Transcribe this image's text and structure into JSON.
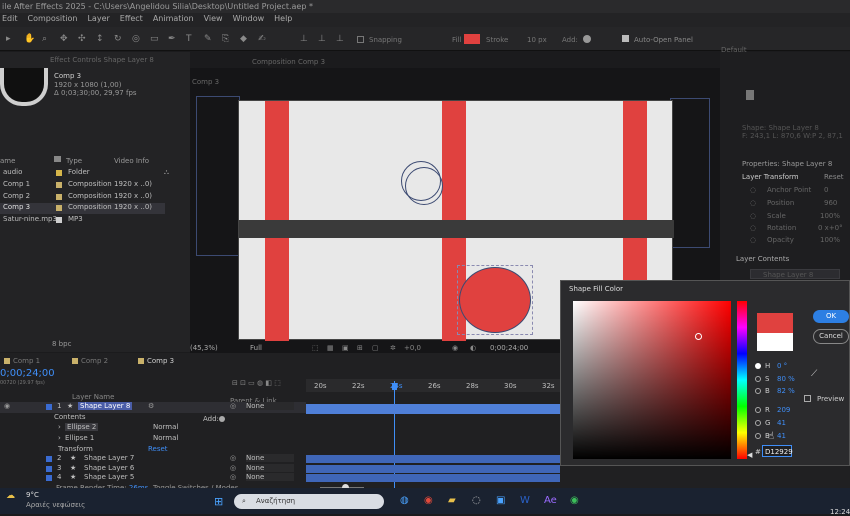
{
  "window": {
    "title": "ile After Effects 2025 - C:\\Users\\Angelidou Silia\\Desktop\\Untitled Project.aep *"
  },
  "menu": [
    "Edit",
    "Composition",
    "Layer",
    "Effect",
    "Animation",
    "View",
    "Window",
    "Help"
  ],
  "toolbar": {
    "snapping": "Snapping",
    "fill": "Fill",
    "stroke": "Stroke",
    "stroke_width": "10 px",
    "add": "Add:",
    "auto_open": "Auto-Open Panel",
    "workspace": "Default",
    "fill_color": "#e0413f"
  },
  "project_panel": {
    "tab_effect": "Effect Controls Shape Layer 8",
    "comp_name": "Comp 3",
    "comp_size": "1920 x 1080 (1,00)",
    "comp_duration": "Δ 0;03;30;00, 29,97 fps",
    "col_name": "ame",
    "col_type": "Type",
    "col_video": "Video Info",
    "items": [
      {
        "name": "audio",
        "type": "Folder",
        "info": "",
        "color": "#d6b64a"
      },
      {
        "name": "Comp 1",
        "type": "Composition",
        "info": "1920 x ..0)",
        "color": "#c9b16a"
      },
      {
        "name": "Comp 2",
        "type": "Composition",
        "info": "1920 x ..0)",
        "color": "#c9b16a"
      },
      {
        "name": "Comp 3",
        "type": "Composition",
        "info": "1920 x ..0)",
        "color": "#c9b16a"
      },
      {
        "name": "Satur-nine.mp3",
        "type": "MP3",
        "info": "",
        "color": "#cfcfcf"
      }
    ],
    "bpc": "8 bpc"
  },
  "viewer": {
    "tab": "Composition Comp 3",
    "crumb": "Comp 3",
    "zoom": "(45,3%)",
    "quality": "Full",
    "exposure": "+0,0",
    "time": "0;00;24;00"
  },
  "properties": {
    "shape_name": "Shape: Shape Layer 8",
    "shape_values": "F: 243,1 L: 870,6 W:P 2, 87,1",
    "panel_title": "Properties: Shape Layer 8",
    "layer_transform": "Layer Transform",
    "reset": "Reset",
    "rows": [
      {
        "label": "Anchor Point",
        "value": "0"
      },
      {
        "label": "Position",
        "value": "960"
      },
      {
        "label": "Scale",
        "value": "100%"
      },
      {
        "label": "Rotation",
        "value": "0 x+0°"
      },
      {
        "label": "Opacity",
        "value": "100%"
      }
    ],
    "layer_contents": "Layer Contents",
    "content_item": "Shape Layer 8"
  },
  "timeline": {
    "tabs": [
      "Comp 1",
      "Comp 2",
      "Comp 3"
    ],
    "timecode": "0;00;24;00",
    "fps": "00720 (29.97 fps)",
    "col_layer": "Layer Name",
    "col_parent": "Parent & Link",
    "ruler": [
      "20s",
      "22s",
      "24s",
      "26s",
      "28s",
      "30s",
      "32s"
    ],
    "layers": [
      {
        "num": "1",
        "name": "Shape Layer 8",
        "parent": "None"
      },
      {
        "num": "2",
        "name": "Shape Layer 7",
        "parent": "None"
      },
      {
        "num": "3",
        "name": "Shape Layer 6",
        "parent": "None"
      },
      {
        "num": "4",
        "name": "Shape Layer 5",
        "parent": "None"
      }
    ],
    "contents": "Contents",
    "add": "Add:",
    "ellipse2": "Ellipse 2",
    "ellipse1": "Ellipse 1",
    "blend": "Normal",
    "transform": "Transform",
    "reset": "Reset",
    "render_label": "Frame Render Time:",
    "render_time": "26ms",
    "toggle": "Toggle Switches / Modes"
  },
  "dialog": {
    "title": "Shape Fill Color",
    "ok": "OK",
    "cancel": "Cancel",
    "preview": "Preview",
    "h_label": "H",
    "h_value": "0 °",
    "s_label": "S",
    "s_value": "80 %",
    "b_label": "B",
    "b_value": "82 %",
    "r_label": "R",
    "r_value": "209",
    "g_label": "G",
    "g_value": "41",
    "bl_label": "B",
    "bl_value": "41",
    "hex_label": "#",
    "hex_value": "D12929",
    "new_color": "#e0413f",
    "old_color": "#ffffff"
  },
  "taskbar": {
    "temp": "9°C",
    "weather": "Αραιές νεφώσεις",
    "search": "Αναζήτηση",
    "clock": "12:24"
  }
}
